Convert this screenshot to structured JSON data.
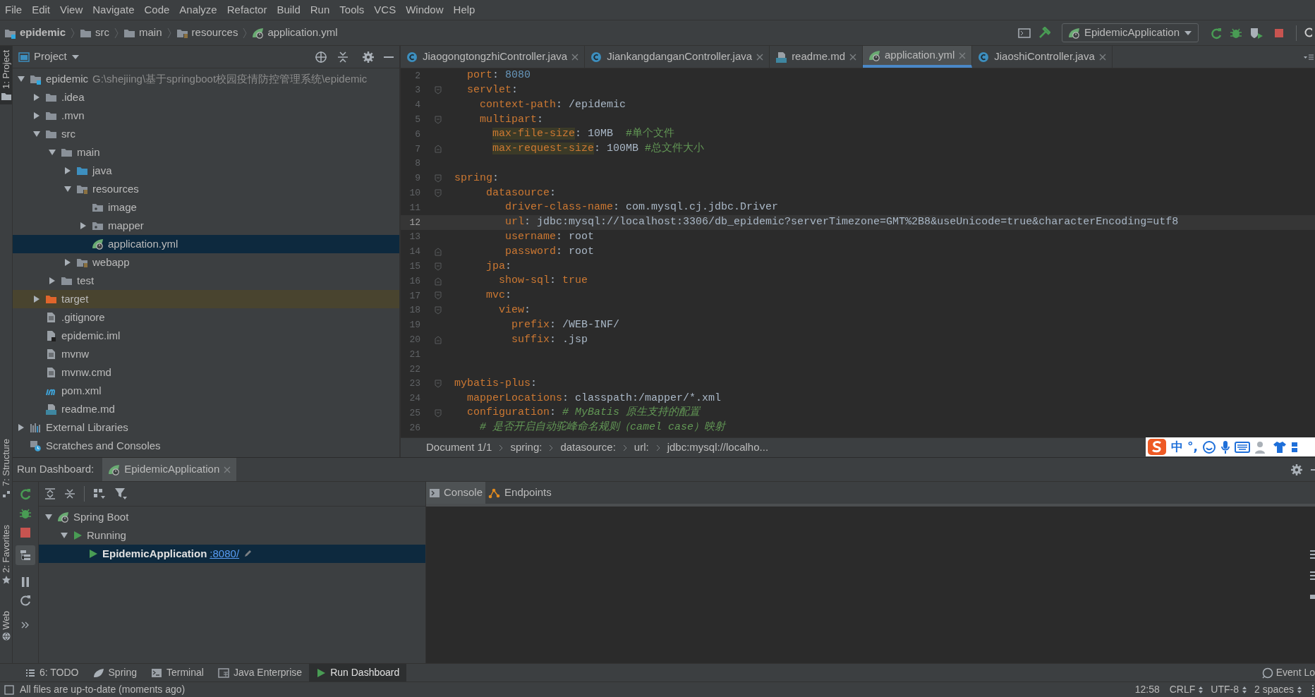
{
  "menu_bar": [
    "File",
    "Edit",
    "View",
    "Navigate",
    "Code",
    "Analyze",
    "Refactor",
    "Build",
    "Run",
    "Tools",
    "VCS",
    "Window",
    "Help"
  ],
  "nav_bar": {
    "breadcrumbs": [
      {
        "label": "epidemic",
        "kind": "module"
      },
      {
        "label": "src",
        "kind": "folder"
      },
      {
        "label": "main",
        "kind": "folder"
      },
      {
        "label": "resources",
        "kind": "resources"
      },
      {
        "label": "application.yml",
        "kind": "spring"
      }
    ],
    "run_config": "EpidemicApplication"
  },
  "side_strip": {
    "top": [
      {
        "label": "1: Project",
        "selected": true
      }
    ],
    "bottom": [
      {
        "label": "7: Structure",
        "selected": false
      },
      {
        "label": "2: Favorites",
        "selected": false
      },
      {
        "label": "Web",
        "selected": false
      }
    ]
  },
  "project_panel": {
    "title": "Project",
    "tree": [
      {
        "name": "epidemic",
        "path": "G:\\shejiing\\基于springboot校园疫情防控管理系统\\epidemic",
        "kind": "module",
        "expanded": true,
        "selected": false,
        "children": [
          {
            "name": ".idea",
            "kind": "folder",
            "expanded": false,
            "selected": false
          },
          {
            "name": ".mvn",
            "kind": "folder",
            "expanded": false,
            "selected": false
          },
          {
            "name": "src",
            "kind": "folder",
            "expanded": true,
            "selected": false,
            "children": [
              {
                "name": "main",
                "kind": "folder",
                "expanded": true,
                "selected": false,
                "children": [
                  {
                    "name": "java",
                    "kind": "source",
                    "expanded": false,
                    "selected": false
                  },
                  {
                    "name": "resources",
                    "kind": "resources",
                    "expanded": true,
                    "selected": false,
                    "children": [
                      {
                        "name": "image",
                        "kind": "package",
                        "selected": false
                      },
                      {
                        "name": "mapper",
                        "kind": "package",
                        "expanded": false,
                        "selected": false
                      },
                      {
                        "name": "application.yml",
                        "kind": "spring",
                        "selected": true
                      }
                    ]
                  },
                  {
                    "name": "webapp",
                    "kind": "resources",
                    "expanded": false,
                    "selected": false
                  }
                ]
              },
              {
                "name": "test",
                "kind": "folder",
                "expanded": false,
                "selected": false
              }
            ]
          },
          {
            "name": "target",
            "kind": "excluded",
            "expanded": false,
            "selected": false
          },
          {
            "name": ".gitignore",
            "kind": "file",
            "selected": false
          },
          {
            "name": "epidemic.iml",
            "kind": "iml",
            "selected": false
          },
          {
            "name": "mvnw",
            "kind": "file",
            "selected": false
          },
          {
            "name": "mvnw.cmd",
            "kind": "file",
            "selected": false
          },
          {
            "name": "pom.xml",
            "kind": "maven",
            "selected": false
          },
          {
            "name": "readme.md",
            "kind": "md",
            "selected": false
          }
        ]
      },
      {
        "name": "External Libraries",
        "kind": "libraries",
        "expanded": false,
        "selected": false
      },
      {
        "name": "Scratches and Consoles",
        "kind": "scratches",
        "selected": false
      }
    ]
  },
  "editor": {
    "tabs": [
      {
        "label": "JiaogongtongzhiController.java",
        "kind": "class",
        "selected": false
      },
      {
        "label": "JiankangdanganController.java",
        "kind": "class",
        "selected": false
      },
      {
        "label": "readme.md",
        "kind": "md",
        "selected": false
      },
      {
        "label": "application.yml",
        "kind": "spring",
        "selected": true
      },
      {
        "label": "JiaoshiController.java",
        "kind": "class",
        "selected": false
      }
    ],
    "lines": [
      {
        "number": "2",
        "fold_start": false,
        "fold_end": false,
        "current": false,
        "segments": [
          {
            "text": "  port",
            "kind": "key"
          },
          {
            "text": ": ",
            "kind": "text"
          },
          {
            "text": "8080",
            "kind": "number"
          }
        ]
      },
      {
        "number": "3",
        "fold_start": true,
        "fold_end": false,
        "current": false,
        "segments": [
          {
            "text": "  servlet",
            "kind": "key"
          },
          {
            "text": ":",
            "kind": "text"
          }
        ]
      },
      {
        "number": "4",
        "fold_start": false,
        "fold_end": false,
        "current": false,
        "segments": [
          {
            "text": "    context-path",
            "kind": "key"
          },
          {
            "text": ": /epidemic",
            "kind": "text"
          }
        ]
      },
      {
        "number": "5",
        "fold_start": true,
        "fold_end": false,
        "current": false,
        "segments": [
          {
            "text": "    multipart",
            "kind": "key"
          },
          {
            "text": ":",
            "kind": "text"
          }
        ]
      },
      {
        "number": "6",
        "fold_start": false,
        "fold_end": false,
        "current": false,
        "segments": [
          {
            "text": "      max-file-size",
            "kind": "key-marked"
          },
          {
            "text": ": 10MB  ",
            "kind": "text"
          },
          {
            "text": "#单个文件",
            "kind": "comment"
          }
        ]
      },
      {
        "number": "7",
        "fold_start": false,
        "fold_end": true,
        "current": false,
        "segments": [
          {
            "text": "      max-request-size",
            "kind": "key-marked"
          },
          {
            "text": ": 100MB ",
            "kind": "text"
          },
          {
            "text": "#总文件大小",
            "kind": "comment"
          }
        ]
      },
      {
        "number": "8",
        "fold_start": false,
        "fold_end": false,
        "current": false
      },
      {
        "number": "9",
        "fold_start": true,
        "fold_end": false,
        "current": false,
        "segments": [
          {
            "text": "spring",
            "kind": "key"
          },
          {
            "text": ":",
            "kind": "text"
          }
        ]
      },
      {
        "number": "10",
        "fold_start": true,
        "fold_end": false,
        "current": false,
        "segments": [
          {
            "text": "     datasource",
            "kind": "key"
          },
          {
            "text": ":",
            "kind": "text"
          }
        ]
      },
      {
        "number": "11",
        "fold_start": false,
        "fold_end": false,
        "current": false,
        "segments": [
          {
            "text": "        driver-class-name",
            "kind": "key"
          },
          {
            "text": ": com.mysql.cj.jdbc.Driver",
            "kind": "text"
          }
        ]
      },
      {
        "number": "12",
        "fold_start": false,
        "fold_end": false,
        "current": true,
        "segments": [
          {
            "text": "        url",
            "kind": "key"
          },
          {
            "text": ": jdbc:mysql://localhost:3306/db_epidemic?serverTimezone=GMT%2B8&useUnicode=true&characterEncoding=utf8",
            "kind": "text"
          }
        ]
      },
      {
        "number": "13",
        "fold_start": false,
        "fold_end": false,
        "current": false,
        "segments": [
          {
            "text": "        username",
            "kind": "key"
          },
          {
            "text": ": root",
            "kind": "text"
          }
        ]
      },
      {
        "number": "14",
        "fold_start": false,
        "fold_end": true,
        "current": false,
        "segments": [
          {
            "text": "        password",
            "kind": "key"
          },
          {
            "text": ": root",
            "kind": "text"
          }
        ]
      },
      {
        "number": "15",
        "fold_start": true,
        "fold_end": false,
        "current": false,
        "segments": [
          {
            "text": "     jpa",
            "kind": "key"
          },
          {
            "text": ":",
            "kind": "text"
          }
        ]
      },
      {
        "number": "16",
        "fold_start": false,
        "fold_end": true,
        "current": false,
        "segments": [
          {
            "text": "       show-sql",
            "kind": "key"
          },
          {
            "text": ": ",
            "kind": "text"
          },
          {
            "text": "true",
            "kind": "bool"
          }
        ]
      },
      {
        "number": "17",
        "fold_start": true,
        "fold_end": false,
        "current": false,
        "segments": [
          {
            "text": "     mvc",
            "kind": "key"
          },
          {
            "text": ":",
            "kind": "text"
          }
        ]
      },
      {
        "number": "18",
        "fold_start": true,
        "fold_end": false,
        "current": false,
        "segments": [
          {
            "text": "       view",
            "kind": "key"
          },
          {
            "text": ":",
            "kind": "text"
          }
        ]
      },
      {
        "number": "19",
        "fold_start": false,
        "fold_end": false,
        "current": false,
        "segments": [
          {
            "text": "         prefix",
            "kind": "key"
          },
          {
            "text": ": /WEB-INF/",
            "kind": "text"
          }
        ]
      },
      {
        "number": "20",
        "fold_start": false,
        "fold_end": true,
        "current": false,
        "segments": [
          {
            "text": "         suffix",
            "kind": "key"
          },
          {
            "text": ": .jsp",
            "kind": "text"
          }
        ]
      },
      {
        "number": "21",
        "fold_start": false,
        "fold_end": false,
        "current": false
      },
      {
        "number": "22",
        "fold_start": false,
        "fold_end": false,
        "current": false
      },
      {
        "number": "23",
        "fold_start": true,
        "fold_end": false,
        "current": false,
        "segments": [
          {
            "text": "mybatis-plus",
            "kind": "key"
          },
          {
            "text": ":",
            "kind": "text"
          }
        ]
      },
      {
        "number": "24",
        "fold_start": false,
        "fold_end": false,
        "current": false,
        "segments": [
          {
            "text": "  mapperLocations",
            "kind": "key"
          },
          {
            "text": ": classpath:/mapper/*.xml",
            "kind": "text"
          }
        ]
      },
      {
        "number": "25",
        "fold_start": true,
        "fold_end": false,
        "current": false,
        "segments": [
          {
            "text": "  configuration",
            "kind": "key"
          },
          {
            "text": ": ",
            "kind": "text"
          },
          {
            "text": "# MyBatis 原生支持的配置",
            "kind": "doc"
          }
        ]
      },
      {
        "number": "26",
        "fold_start": false,
        "fold_end": false,
        "current": false,
        "segments": [
          {
            "text": "    # 是否开启自动驼峰命名规则（camel case）映射",
            "kind": "doc"
          }
        ]
      }
    ],
    "breadcrumbs": [
      "Document 1/1",
      "spring:",
      "datasource:",
      "url:",
      "jdbc:mysql://localho..."
    ]
  },
  "ime_bar": {
    "items": [
      "中",
      "°,"
    ]
  },
  "run_dashboard": {
    "title": "Run Dashboard:",
    "tab": "EpidemicApplication",
    "tree": [
      {
        "name": "Spring Boot",
        "kind": "spring",
        "expanded": true,
        "selected": false,
        "children": [
          {
            "name": "Running",
            "kind": "run",
            "expanded": true,
            "selected": false,
            "children": [
              {
                "name": "EpidemicApplication",
                "link": ":8080/",
                "kind": "run",
                "selected": true
              }
            ]
          }
        ]
      }
    ],
    "console_tabs": [
      {
        "label": "Console",
        "kind": "console",
        "selected": true
      },
      {
        "label": "Endpoints",
        "kind": "endpoints",
        "selected": false
      }
    ]
  },
  "tool_tabs": [
    {
      "label": "6: TODO",
      "kind": "todo",
      "selected": false
    },
    {
      "label": "Spring",
      "kind": "spring",
      "selected": false
    },
    {
      "label": "Terminal",
      "kind": "terminal",
      "selected": false
    },
    {
      "label": "Java Enterprise",
      "kind": "enterprise",
      "selected": false
    },
    {
      "label": "Run Dashboard",
      "kind": "run",
      "selected": true
    }
  ],
  "event_log": "Event Lo",
  "status_bar": {
    "message": "All files are up-to-date (moments ago)",
    "position": "12:58",
    "line_separator": "CRLF",
    "encoding": "UTF-8",
    "indent": "2 spaces"
  }
}
